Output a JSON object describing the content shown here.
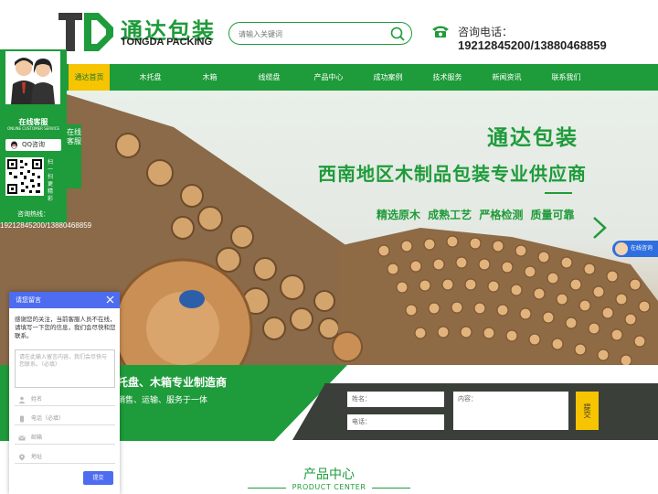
{
  "brand": {
    "name_cn": "通达包装",
    "name_en": "TONGDA PACKING"
  },
  "search": {
    "placeholder": "请输入关键词"
  },
  "contact": {
    "label": "咨询电话：",
    "numbers": "19212845200/13880468859"
  },
  "nav": {
    "items": [
      "通达首页",
      "木托盘",
      "木箱",
      "线缆盘",
      "产品中心",
      "成功案例",
      "技术服务",
      "新闻资讯",
      "联系我们"
    ]
  },
  "banner": {
    "title": "通达包装",
    "subtitle": "西南地区木制品包装专业供应商",
    "features": "精选原木 成熟工艺 严格检测 质量可靠"
  },
  "slogan": {
    "line1": "托盘、木箱专业制造商",
    "line2": "销售、运输、服务于一体"
  },
  "quote_form": {
    "name_label": "姓名：",
    "phone_label": "电话：",
    "content_label": "内容：",
    "submit": "提交"
  },
  "product_center": {
    "title": "产品中心",
    "subtitle": "PRODUCT CENTER"
  },
  "customer_service": {
    "title": "在线客服",
    "title_en": "ONLINE CUSTOMER SERVICE",
    "qq_label": "QQ咨询",
    "scan_text": "扫一扫更精彩",
    "tab_text": "在线客服",
    "hotline_label": "咨询热线：",
    "hotline_numbers": "19212845200/13880468859"
  },
  "consult_tag": {
    "label": "在线咨询"
  },
  "message_widget": {
    "header": "请您留言",
    "intro": "感谢您的关注，当前客服人员不在线，请填写一下您的信息，我们会尽快和您联系。",
    "textarea_placeholder": "请在此输入留言内容，我们会尽快与您联系。（必填）",
    "fields": [
      "姓名",
      "电话（必填）",
      "邮箱",
      "地址"
    ],
    "submit": "提交"
  },
  "colors": {
    "brand_green": "#1e9b3a",
    "accent_yellow": "#f6c400",
    "widget_blue": "#4e6cf0",
    "form_dark": "#3a3f3a"
  }
}
